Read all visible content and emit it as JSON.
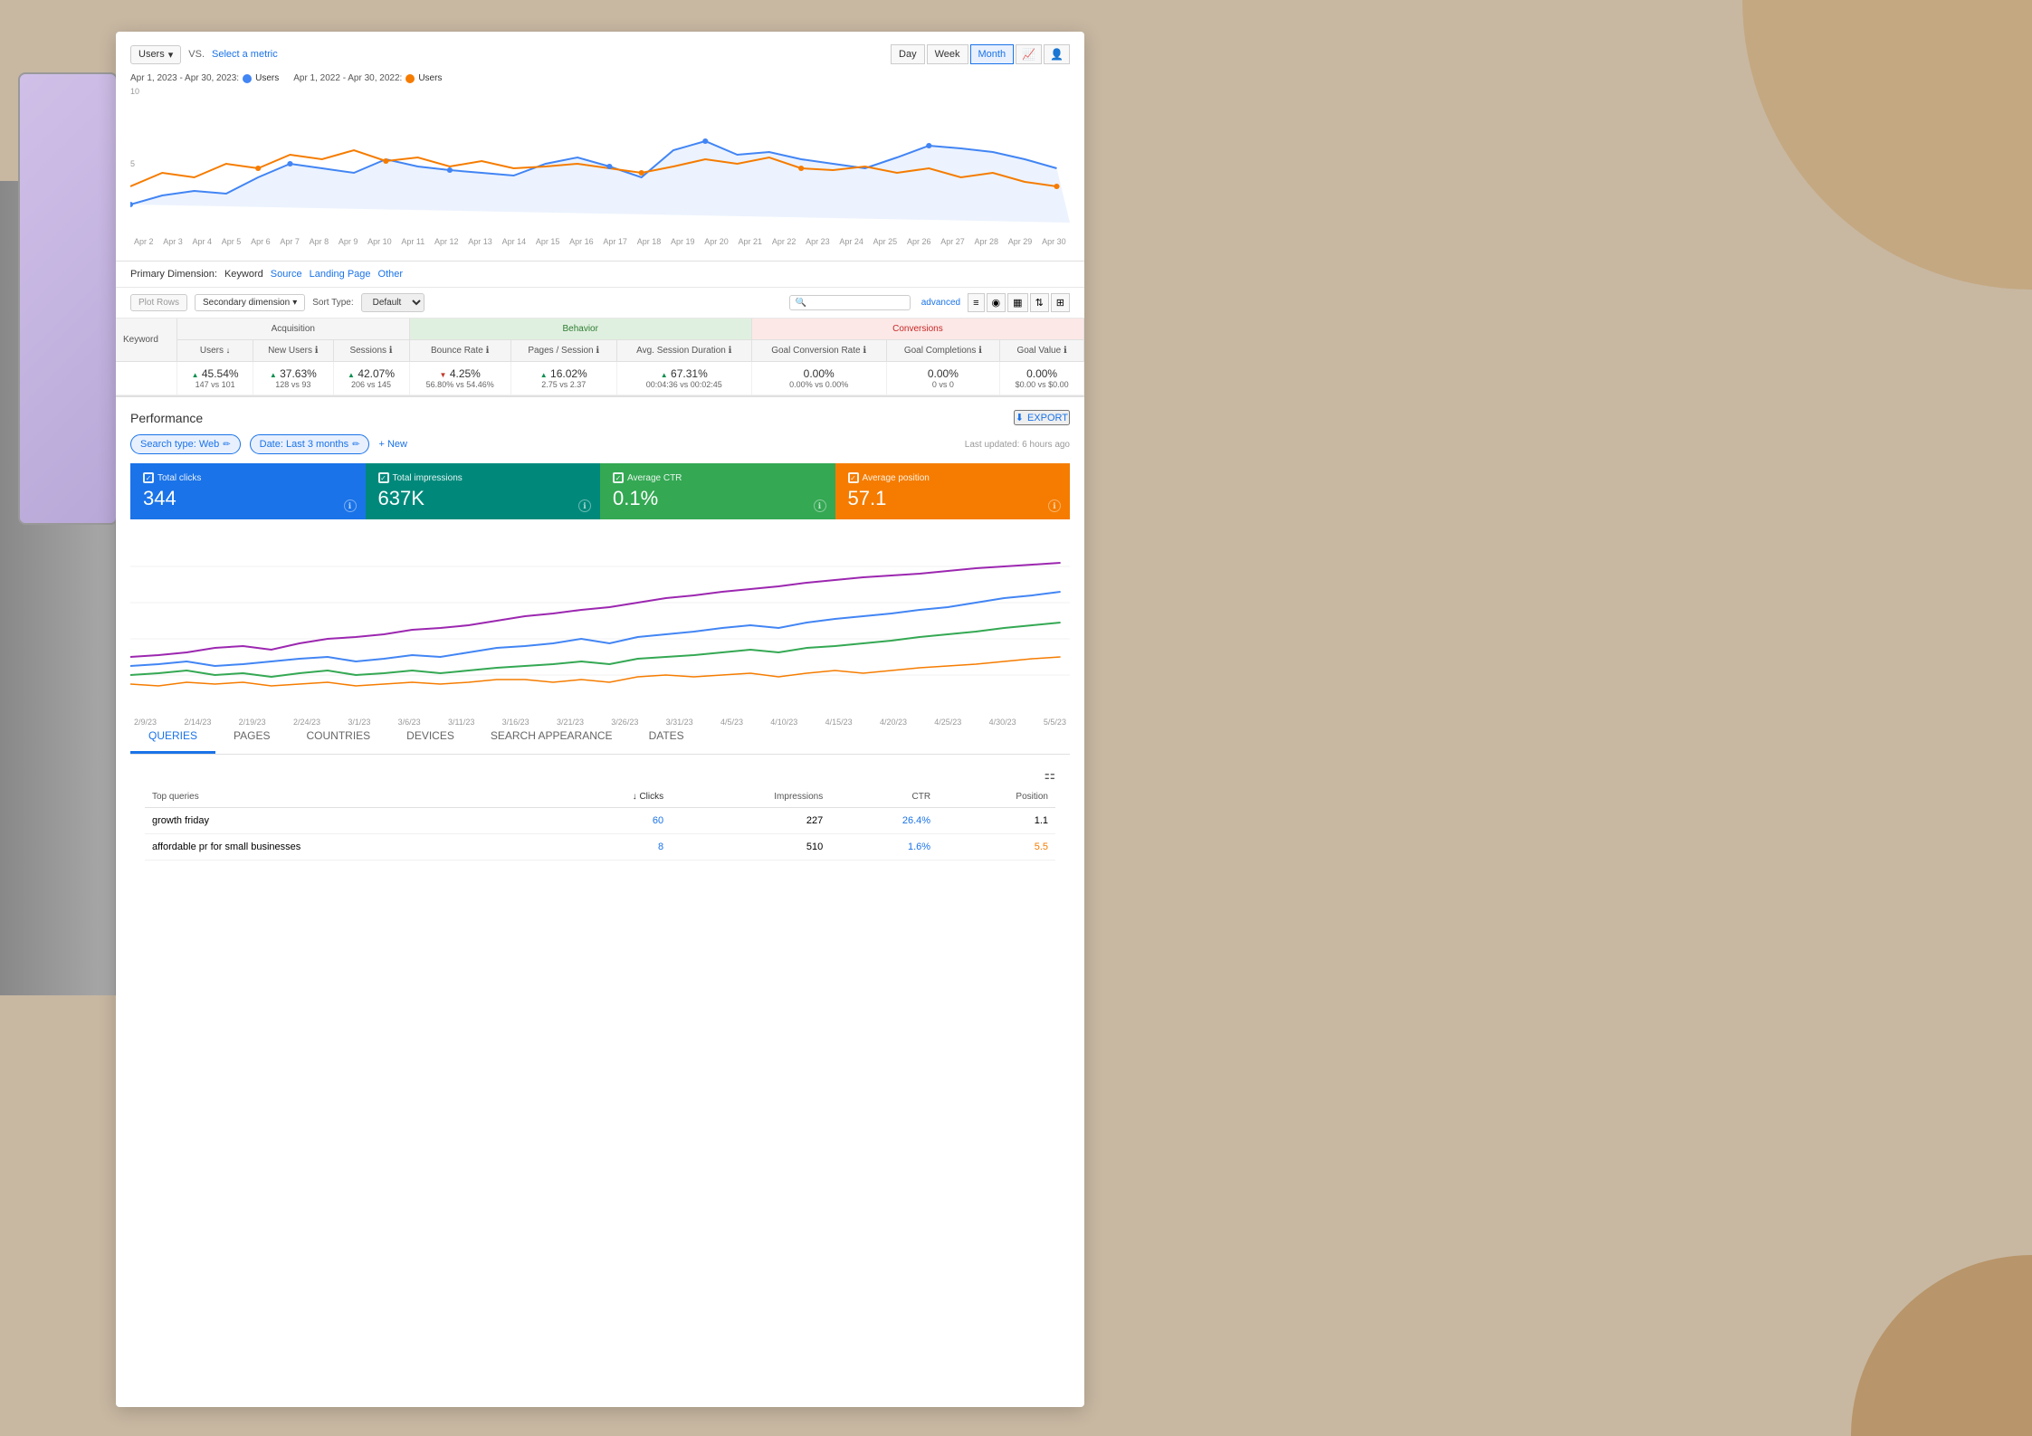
{
  "background": {
    "color": "#c8b8a2"
  },
  "analytics": {
    "metric_selector": {
      "left_metric": "Users",
      "vs_text": "VS.",
      "select_metric_text": "Select a metric"
    },
    "date_toggle": {
      "day_label": "Day",
      "week_label": "Week",
      "month_label": "Month"
    },
    "legend": [
      {
        "label": "Apr 1, 2023 - Apr 30, 2023:",
        "series": "Users",
        "color": "#4285f4"
      },
      {
        "label": "Apr 1, 2022 - Apr 30, 2022:",
        "series": "Users",
        "color": "#f57c00"
      }
    ],
    "chart_y_labels": [
      "10",
      "5"
    ],
    "chart_x_labels": [
      "Apr 2",
      "Apr 3",
      "Apr 4",
      "Apr 5",
      "Apr 6",
      "Apr 7",
      "Apr 8",
      "Apr 9",
      "Apr 10",
      "Apr 11",
      "Apr 12",
      "Apr 13",
      "Apr 14",
      "Apr 15",
      "Apr 16",
      "Apr 17",
      "Apr 18",
      "Apr 19",
      "Apr 20",
      "Apr 21",
      "Apr 22",
      "Apr 23",
      "Apr 24",
      "Apr 25",
      "Apr 26",
      "Apr 27",
      "Apr 28",
      "Apr 29",
      "Apr 30"
    ]
  },
  "dimensions": {
    "primary_label": "Primary Dimension:",
    "keyword": "Keyword",
    "source": "Source",
    "landing_page": "Landing Page",
    "other": "Other"
  },
  "controls": {
    "plot_rows": "Plot Rows",
    "secondary_dimension": "Secondary dimension",
    "sort_type_label": "Sort Type:",
    "sort_default": "Default",
    "advanced_link": "advanced"
  },
  "table": {
    "columns": {
      "keyword": "Keyword",
      "sections": {
        "acquisition": "Acquisition",
        "behavior": "Behavior",
        "conversions": "Conversions"
      },
      "acquisition_cols": [
        "Users",
        "New Users",
        "Sessions"
      ],
      "behavior_cols": [
        "Bounce Rate",
        "Pages / Session",
        "Avg. Session Duration"
      ],
      "conversion_cols": [
        "Goal Conversion Rate",
        "Goal Completions",
        "Goal Value"
      ]
    },
    "data_row": {
      "users": {
        "value": "45.54%",
        "trend": "up",
        "sub": "147 vs 101"
      },
      "new_users": {
        "value": "37.63%",
        "trend": "up",
        "sub": "128 vs 93"
      },
      "sessions": {
        "value": "42.07%",
        "trend": "up",
        "sub": "206 vs 145"
      },
      "bounce_rate": {
        "value": "4.25%",
        "trend": "down",
        "sub": "56.80% vs 54.46%"
      },
      "pages_session": {
        "value": "16.02%",
        "trend": "up",
        "sub": "2.75 vs 2.37"
      },
      "avg_session": {
        "value": "67.31%",
        "trend": "up",
        "sub": "00:04:36 vs 00:02:45"
      },
      "goal_conversion": {
        "value": "0.00%",
        "sub": "0.00% vs 0.00%"
      },
      "goal_completions": {
        "value": "0.00%",
        "sub": "0 vs 0"
      },
      "goal_value": {
        "value": "0.00%",
        "sub": "$0.00 vs $0.00"
      }
    }
  },
  "performance": {
    "title": "Performance",
    "export_label": "EXPORT",
    "filters": {
      "search_type": "Search type: Web",
      "date_range": "Date: Last 3 months"
    },
    "new_filter": "+ New",
    "last_updated": "Last updated: 6 hours ago",
    "metric_cards": [
      {
        "label": "Total clicks",
        "value": "344",
        "color": "blue"
      },
      {
        "label": "Total impressions",
        "value": "637K",
        "color": "teal"
      },
      {
        "label": "Average CTR",
        "value": "0.1%",
        "color": "green"
      },
      {
        "label": "Average position",
        "value": "57.1",
        "color": "orange"
      }
    ]
  },
  "tabs": {
    "items": [
      "QUERIES",
      "PAGES",
      "COUNTRIES",
      "DEVICES",
      "SEARCH APPEARANCE",
      "DATES"
    ]
  },
  "queries_table": {
    "header_label": "Top queries",
    "columns": [
      "Top queries",
      "↓ Clicks",
      "Impressions",
      "CTR",
      "Position"
    ],
    "rows": [
      {
        "query": "growth friday",
        "clicks": "60",
        "impressions": "227",
        "ctr": "26.4%",
        "position": "1.1"
      },
      {
        "query": "affordable pr for small businesses",
        "clicks": "8",
        "impressions": "510",
        "ctr": "1.6%",
        "position": "5.5"
      }
    ]
  }
}
